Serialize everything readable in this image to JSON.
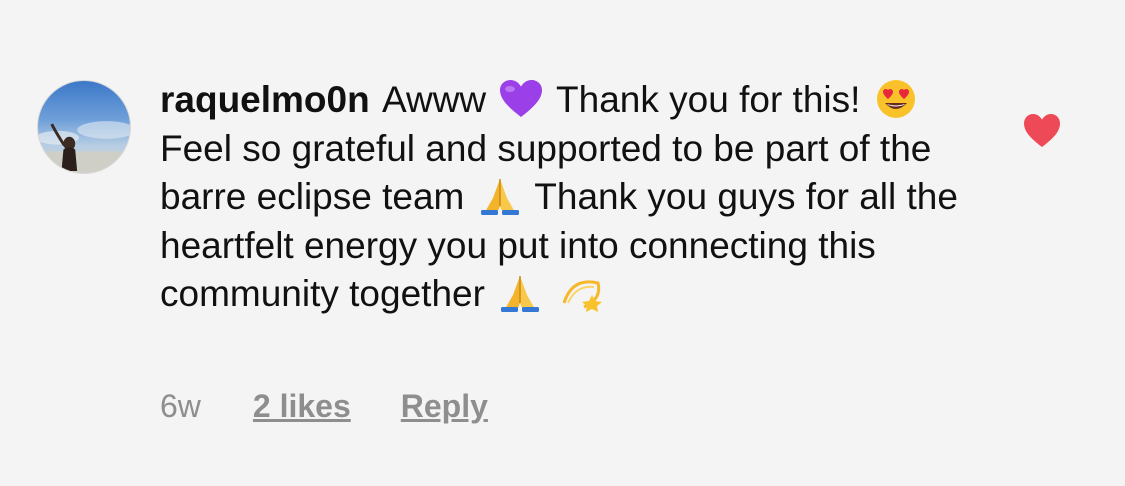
{
  "comment": {
    "username": "raquelmo0n",
    "segments": {
      "s1": "Awww",
      "s2": "Thank you for this!",
      "s3": "Feel so grateful and supported to be part of the barre eclipse team",
      "s4": "Thank you guys for all the heartfelt energy you put into connecting this community together"
    },
    "emojis": {
      "e1": "purple-heart-icon",
      "e2": "heart-eyes-face-icon",
      "e3": "folded-hands-icon",
      "e4": "folded-hands-icon",
      "e5": "dizzy-star-icon"
    },
    "liked": true,
    "like_color": "#ed4956"
  },
  "meta": {
    "time": "6w",
    "likes": "2 likes",
    "reply": "Reply"
  }
}
